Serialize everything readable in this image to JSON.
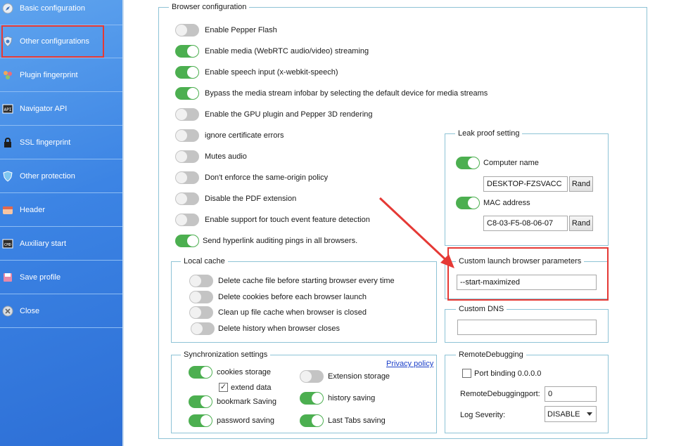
{
  "sidebar": {
    "items": [
      {
        "label": "Basic configuration",
        "icon": "compass-icon"
      },
      {
        "label": "Other configurations",
        "icon": "shield-icon"
      },
      {
        "label": "Plugin fingerprint",
        "icon": "puzzle-icon"
      },
      {
        "label": "Navigator API",
        "icon": "api-icon"
      },
      {
        "label": "SSL fingerprint",
        "icon": "lock-icon"
      },
      {
        "label": "Other protection",
        "icon": "protection-icon"
      },
      {
        "label": "Header",
        "icon": "header-icon"
      },
      {
        "label": "Auxiliary start",
        "icon": "cmd-icon"
      },
      {
        "label": "Save profile",
        "icon": "save-icon"
      },
      {
        "label": "Close",
        "icon": "close-icon"
      }
    ],
    "selected": "Other configurations"
  },
  "browser_config": {
    "title": "Browser configuration",
    "toggles": [
      {
        "label": "Enable Pepper Flash",
        "on": false
      },
      {
        "label": "Enable media (WebRTC audio/video) streaming",
        "on": true
      },
      {
        "label": "Enable speech input (x-webkit-speech)",
        "on": true
      },
      {
        "label": "Bypass the media stream infobar by selecting the default device for media streams",
        "on": true
      },
      {
        "label": "Enable the GPU plugin and Pepper 3D rendering",
        "on": false
      },
      {
        "label": "ignore certificate errors",
        "on": false
      },
      {
        "label": "Mutes audio",
        "on": false
      },
      {
        "label": "Don't enforce the same-origin policy",
        "on": false
      },
      {
        "label": "Disable the PDF extension",
        "on": false
      },
      {
        "label": "Enable support for touch event feature detection",
        "on": false
      },
      {
        "label": "Send hyperlink auditing pings in all browsers.",
        "on": true
      }
    ]
  },
  "local_cache": {
    "title": "Local cache",
    "toggles": [
      {
        "label": "Delete cache file before starting browser every time",
        "on": false
      },
      {
        "label": "Delete cookies before each browser launch",
        "on": false
      },
      {
        "label": "Clean up file cache when browser is closed",
        "on": false
      },
      {
        "label": "Delete history when browser closes",
        "on": false
      }
    ]
  },
  "sync": {
    "title": "Synchronization settings",
    "privacy_link": "Privacy policy",
    "cookies": {
      "label": "cookies storage",
      "on": true
    },
    "extend_data": {
      "label": "extend data",
      "checked": true
    },
    "bookmark": {
      "label": "bookmark Saving",
      "on": true
    },
    "password": {
      "label": "password saving",
      "on": true
    },
    "extension": {
      "label": "Extension storage",
      "on": false
    },
    "history": {
      "label": "history saving",
      "on": true
    },
    "last_tabs": {
      "label": "Last Tabs saving",
      "on": true
    }
  },
  "leak_proof": {
    "title": "Leak proof setting",
    "computer_name": {
      "label": "Computer name",
      "on": true,
      "value": "DESKTOP-FZSVACC"
    },
    "mac_address": {
      "label": "MAC address",
      "on": true,
      "value": "C8-03-F5-08-06-07"
    },
    "rand_label": "Rand"
  },
  "custom_launch": {
    "title": "Custom launch browser parameters",
    "value": "--start-maximized"
  },
  "custom_dns": {
    "title": "Custom DNS",
    "value": ""
  },
  "remote_debugging": {
    "title": "RemoteDebugging",
    "port_binding": {
      "label": "Port binding 0.0.0.0",
      "checked": false
    },
    "port_label": "RemoteDebuggingport:",
    "port_value": "0",
    "log_label": "Log Severity:",
    "log_value": "DISABLE"
  },
  "colors": {
    "accent_red": "#e53935",
    "toggle_on": "#4caf50",
    "toggle_off": "#c4c4c4",
    "sidebar_blue": "#3c84e4"
  }
}
